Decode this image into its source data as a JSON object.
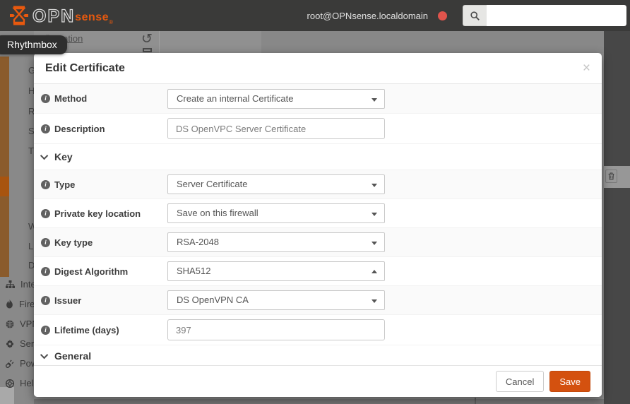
{
  "navbar": {
    "logo": {
      "brand_prefix": "OPN",
      "brand_suffix": "sense",
      "reg_mark": "®"
    },
    "user": "root@OPNsense.localdomain",
    "status_dot_color": "#e0544c",
    "search": {
      "value": "",
      "placeholder": ""
    }
  },
  "os_tooltip": {
    "label": "Rhythmbox"
  },
  "background": {
    "breadcrumb_partial": "Configuration",
    "undo_glyph": "↺",
    "submenu_letters": [
      "G",
      "H",
      "R",
      "S",
      "T",
      "W",
      "L",
      "D"
    ],
    "menu_items": [
      {
        "icon": "sitemap-icon",
        "label": "Inte"
      },
      {
        "icon": "fire-icon",
        "label": "Fire"
      },
      {
        "icon": "globe-icon",
        "label": "VPN"
      },
      {
        "icon": "gear-icon",
        "label": "Serv"
      },
      {
        "icon": "power-plug-icon",
        "label": "Pow"
      },
      {
        "icon": "life-ring-icon",
        "label": "Hel"
      }
    ]
  },
  "modal": {
    "title": "Edit Certificate",
    "close_label": "×",
    "fields": [
      {
        "label": "Method",
        "type": "select",
        "value": "Create an internal Certificate",
        "caret_direction": "down"
      },
      {
        "label": "Description",
        "type": "text",
        "value": "DS OpenVPC Server Certificate"
      },
      {
        "label": "Type",
        "type": "select",
        "value": "Server Certificate",
        "caret_direction": "down"
      },
      {
        "label": "Private key location",
        "type": "select",
        "value": "Save on this firewall",
        "caret_direction": "down"
      },
      {
        "label": "Key type",
        "type": "select",
        "value": "RSA-2048",
        "caret_direction": "down"
      },
      {
        "label": "Digest Algorithm",
        "type": "select",
        "value": "SHA512",
        "caret_direction": "up"
      },
      {
        "label": "Issuer",
        "type": "select",
        "value": "DS OpenVPN CA",
        "caret_direction": "down"
      },
      {
        "label": "Lifetime (days)",
        "type": "text",
        "value": "397"
      }
    ],
    "sections": [
      {
        "label": "Key"
      },
      {
        "label": "General"
      }
    ],
    "footer": {
      "cancel_label": "Cancel",
      "save_label": "Save"
    },
    "colors": {
      "save_bg": "#d4510f",
      "navbar_bg": "#3a3a39",
      "accent_orange": "#e8590e"
    }
  }
}
